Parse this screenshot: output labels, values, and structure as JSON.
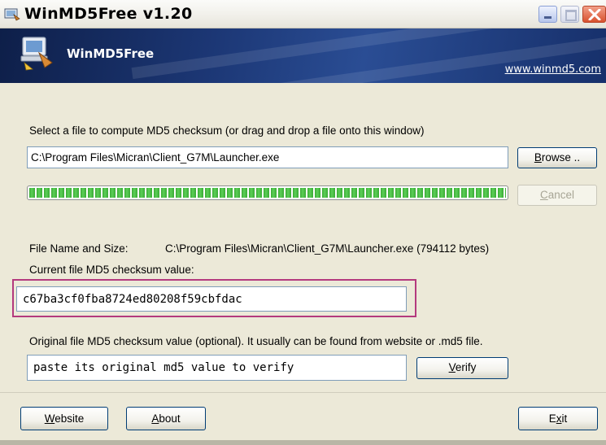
{
  "window": {
    "title": "WinMD5Free v1.20"
  },
  "banner": {
    "title": "WinMD5Free",
    "link": "www.winmd5.com"
  },
  "main": {
    "select_label": "Select a file to compute MD5 checksum (or drag and drop a file onto this window)",
    "file_path": "C:\\Program Files\\Micran\\Client_G7M\\Launcher.exe",
    "browse_prefix": "",
    "browse_accel": "B",
    "browse_rest": "rowse ..",
    "cancel_accel": "C",
    "cancel_rest": "ancel",
    "progress_fraction": 1.0,
    "file_name_size_label": "File Name and Size:",
    "file_name_size_value": "C:\\Program Files\\Micran\\Client_G7M\\Launcher.exe (794112 bytes)",
    "current_md5_label": "Current file MD5 checksum value:",
    "current_md5_value": "c67ba3cf0fba8724ed80208f59cbfdac",
    "original_md5_label": "Original file MD5 checksum value (optional). It usually can be found from website or .md5 file.",
    "original_md5_placeholder": "paste its original md5 value to verify",
    "verify_accel": "V",
    "verify_rest": "erify"
  },
  "footer": {
    "website_accel": "W",
    "website_rest": "ebsite",
    "about_accel": "A",
    "about_rest": "bout",
    "exit_prefix": "E",
    "exit_accel": "x",
    "exit_rest": "it"
  },
  "colors": {
    "highlight_border": "#b43a7e",
    "progress_green": "#3aaa35",
    "banner_blue": "#1c3775"
  }
}
